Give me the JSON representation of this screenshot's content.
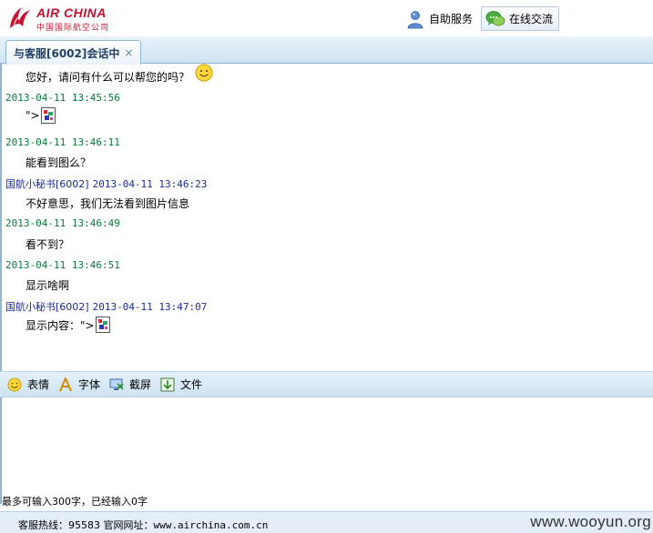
{
  "header": {
    "logo_name": "AIR CHINA",
    "logo_cn": "中国国际航空公司",
    "self_service_label": "自助服务",
    "online_chat_label": "在线交流"
  },
  "tab": {
    "label": "与客服[6002]会话中",
    "close": "×"
  },
  "chat": {
    "greeting": "您好，请问有什么可以帮您的吗？",
    "t1": "2013-04-11 13:45:56",
    "m1": "\">",
    "t2": "2013-04-11 13:46:11",
    "m2": "能看到图么？",
    "a1_name": "国航小秘书[6002]",
    "a1_time": "2013-04-11 13:46:23",
    "m3": "不好意思，我们无法看到图片信息",
    "t3": "2013-04-11 13:46:49",
    "m4": "看不到？",
    "t4": "2013-04-11 13:46:51",
    "m5": "显示啥啊",
    "a2_name": "国航小秘书[6002]",
    "a2_time": "2013-04-11 13:47:07",
    "m6": "显示内容：\">"
  },
  "toolbar": {
    "emoticon": "表情",
    "font": "字体",
    "screenshot": "截屏",
    "file": "文件"
  },
  "input": {
    "value": "",
    "counter": "最多可输入300字，已经输入0字"
  },
  "footer": {
    "hotline_label": "客服热线：",
    "hotline_number": "95583",
    "site_label": "官网网址：",
    "site_url": "www.airchina.com.cn",
    "watermark": "www.wooyun.org"
  },
  "colors": {
    "brand_red": "#c8102e",
    "timestamp_green": "#0b7a3b",
    "agent_blue": "#1a2a9a",
    "panel_blue": "#cfe3f3"
  },
  "icons": {
    "self_service": "person-icon",
    "online_chat": "chat-bubbles-icon",
    "emoticon": "smiley-icon",
    "font": "font-icon",
    "screenshot": "screenshot-icon",
    "file": "file-icon"
  }
}
